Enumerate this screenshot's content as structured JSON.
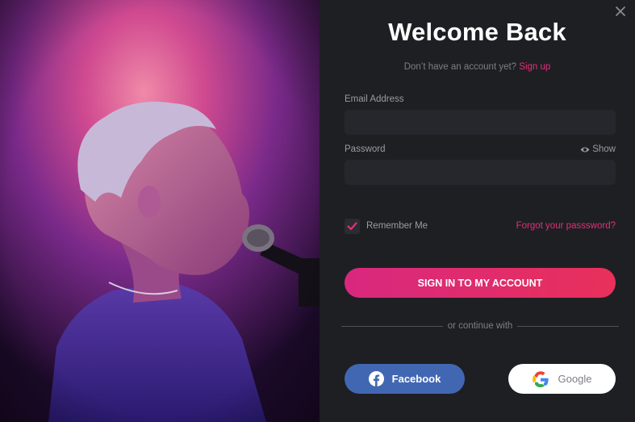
{
  "dialog": {
    "title": "Welcome Back",
    "subtitle_text": "Don’t have an account yet?",
    "signup_link": "Sign up"
  },
  "form": {
    "email_label": "Email Address",
    "email_value": "",
    "password_label": "Password",
    "password_value": "",
    "show_label": "Show",
    "remember_label": "Remember Me",
    "remember_checked": true,
    "forgot_label": "Forgot your passsword?",
    "submit_label": "SIGN IN TO MY ACCOUNT"
  },
  "social": {
    "divider_text": "or continue with",
    "facebook_label": "Facebook",
    "google_label": "Google"
  },
  "colors": {
    "accent": "#e0307a",
    "panel_bg": "#1e1f23",
    "facebook": "#4267b2"
  },
  "icons": {
    "close": "close-icon",
    "eye": "eye-icon",
    "check": "checkmark-icon",
    "facebook": "facebook-icon",
    "google": "google-icon"
  }
}
